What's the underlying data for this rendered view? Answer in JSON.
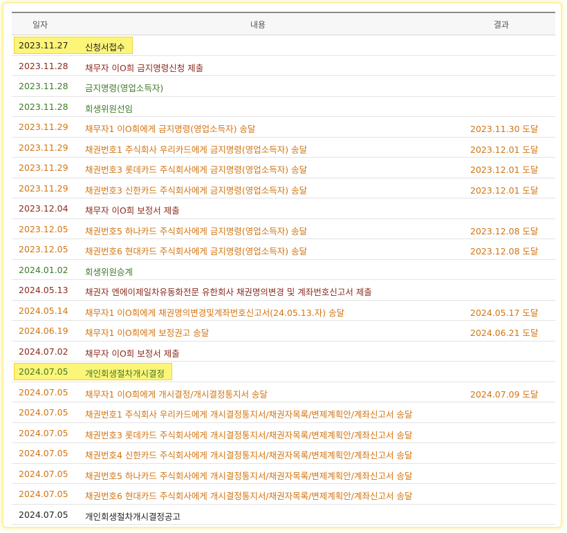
{
  "header": {
    "date": "일자",
    "content": "내용",
    "result": "결과"
  },
  "rows": [
    {
      "date": "2023.11.27",
      "content": "신청서접수",
      "result": "",
      "tone": "black",
      "highlight": true
    },
    {
      "date": "2023.11.28",
      "content": "채무자 이O희 금지명령신청 제출",
      "result": "",
      "tone": "maroon",
      "highlight": false
    },
    {
      "date": "2023.11.28",
      "content": "금지명령(영업소득자)",
      "result": "",
      "tone": "green",
      "highlight": false
    },
    {
      "date": "2023.11.28",
      "content": "회생위원선임",
      "result": "",
      "tone": "green",
      "highlight": false
    },
    {
      "date": "2023.11.29",
      "content": "채무자1 이O희에게 금지명령(영업소득자) 송달",
      "result": "2023.11.30 도달",
      "tone": "orange",
      "highlight": false
    },
    {
      "date": "2023.11.29",
      "content": "채권번호1 주식회사 우리카드에게 금지명령(영업소득자) 송달",
      "result": "2023.12.01 도달",
      "tone": "orange",
      "highlight": false
    },
    {
      "date": "2023.11.29",
      "content": "채권번호3 롯데카드 주식회사에게 금지명령(영업소득자) 송달",
      "result": "2023.12.01 도달",
      "tone": "orange",
      "highlight": false
    },
    {
      "date": "2023.11.29",
      "content": "채권번호3 신한카드 주식회사에게 금지명령(영업소득자) 송달",
      "result": "2023.12.01 도달",
      "tone": "orange",
      "highlight": false
    },
    {
      "date": "2023.12.04",
      "content": "채무자 이O희 보정서 제출",
      "result": "",
      "tone": "maroon",
      "highlight": false
    },
    {
      "date": "2023.12.05",
      "content": "채권번호5 하나카드 주식회사에게 금지명령(영업소득자) 송달",
      "result": "2023.12.08 도달",
      "tone": "orange",
      "highlight": false
    },
    {
      "date": "2023.12.05",
      "content": "채권번호6 현대카드 주식회사에게 금지명령(영업소득자) 송달",
      "result": "2023.12.08 도달",
      "tone": "orange",
      "highlight": false
    },
    {
      "date": "2024.01.02",
      "content": "회생위원승계",
      "result": "",
      "tone": "green",
      "highlight": false
    },
    {
      "date": "2024.05.13",
      "content": "채권자 엔에이제일차유동화전문 유한회사 채권명의변경 및 계좌번호신고서 제출",
      "result": "",
      "tone": "maroon",
      "highlight": false
    },
    {
      "date": "2024.05.14",
      "content": "채무자1 이O희에게 채권명의변경및계좌번호신고서(24.05.13.자) 송달",
      "result": "2024.05.17 도달",
      "tone": "orange",
      "highlight": false
    },
    {
      "date": "2024.06.19",
      "content": "채무자1 이O희에게 보정권고 송달",
      "result": "2024.06.21 도달",
      "tone": "orange",
      "highlight": false
    },
    {
      "date": "2024.07.02",
      "content": "채무자 이O희 보정서 제출",
      "result": "",
      "tone": "maroon",
      "highlight": false
    },
    {
      "date": "2024.07.05",
      "content": "개인회생절차개시결정",
      "result": "",
      "tone": "green",
      "highlight": true
    },
    {
      "date": "2024.07.05",
      "content": "채무자1 이O희에게 개시결정/개시결정통지서 송달",
      "result": "2024.07.09 도달",
      "tone": "orange",
      "highlight": false
    },
    {
      "date": "2024.07.05",
      "content": "채권번호1 주식회사 우리카드에게 개시결정통지서/채권자목록/변제계획안/계좌신고서 송달",
      "result": "",
      "tone": "orange",
      "highlight": false
    },
    {
      "date": "2024.07.05",
      "content": "채권번호3 롯데카드 주식회사에게 개시결정통지서/채권자목록/변제계획안/계좌신고서 송달",
      "result": "",
      "tone": "orange",
      "highlight": false
    },
    {
      "date": "2024.07.05",
      "content": "채권번호4 신한카드 주식회사에게 개시결정통지서/채권자목록/변제계획안/계좌신고서 송달",
      "result": "",
      "tone": "orange",
      "highlight": false
    },
    {
      "date": "2024.07.05",
      "content": "채권번호5 하나카드 주식회사에게 개시결정통지서/채권자목록/변제계획안/계좌신고서 송달",
      "result": "",
      "tone": "orange",
      "highlight": false
    },
    {
      "date": "2024.07.05",
      "content": "채권번호6 현대카드 주식회사에게 개시결정통지서/채권자목록/변제계획안/계좌신고서 송달",
      "result": "",
      "tone": "orange",
      "highlight": false
    },
    {
      "date": "2024.07.05",
      "content": "개인회생절차개시결정공고",
      "result": "",
      "tone": "black",
      "highlight": false
    }
  ],
  "colors": {
    "orange": "#d27411",
    "maroon": "#8b2a1c",
    "green": "#3f7a28",
    "black": "#222222",
    "highlight": "#fdf578",
    "frame": "#fbf1a0"
  }
}
